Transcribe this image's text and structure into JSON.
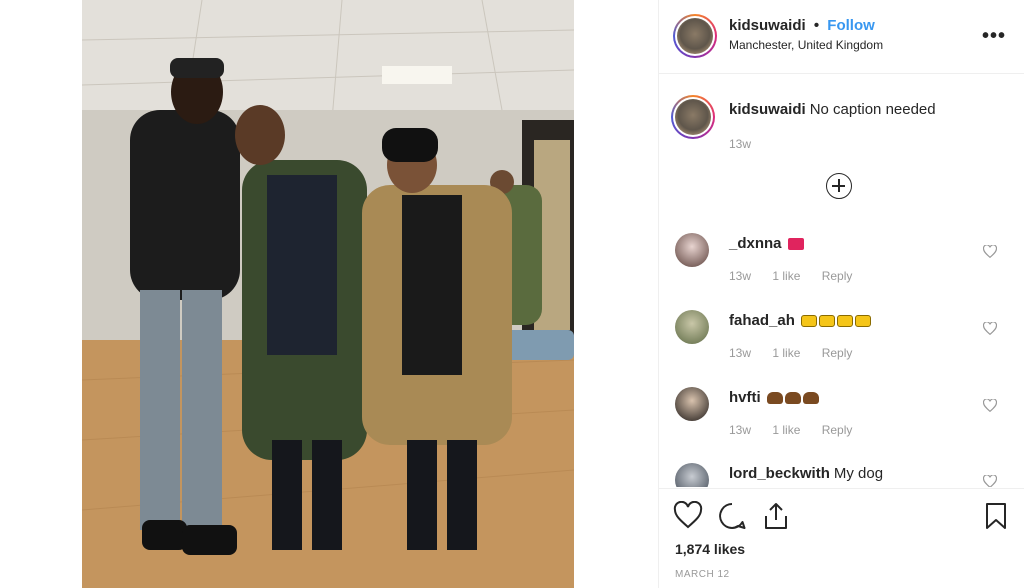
{
  "post": {
    "author": "kidsuwaidi",
    "follow_label": "Follow",
    "separator": "•",
    "location": "Manchester, United Kingdom",
    "more_label": "•••"
  },
  "caption": {
    "user": "kidsuwaidi",
    "text": "No caption needed",
    "time": "13w"
  },
  "comments": [
    {
      "user": "_dxnna",
      "text": "",
      "emoji": "hundred-points",
      "time": "13w",
      "likes": "1 like",
      "reply": "Reply"
    },
    {
      "user": "fahad_ah",
      "text": "",
      "emoji": "crown x4",
      "time": "13w",
      "likes": "1 like",
      "reply": "Reply"
    },
    {
      "user": "hvfti",
      "text": "",
      "emoji": "flexed-biceps x3",
      "time": "13w",
      "likes": "1 like",
      "reply": "Reply"
    },
    {
      "user": "lord_beckwith",
      "text": "My dog",
      "emoji": "",
      "time": "",
      "likes": "",
      "reply": ""
    }
  ],
  "footer": {
    "likes": "1,874 likes",
    "date": "MARCH 12"
  },
  "icons": {
    "like": "heart-icon",
    "comment": "comment-icon",
    "share": "share-icon",
    "save": "bookmark-icon",
    "load_more": "plus-circle-icon"
  },
  "colors": {
    "link": "#3897f0",
    "muted": "#999999",
    "text": "#262626",
    "border": "#efefef"
  }
}
